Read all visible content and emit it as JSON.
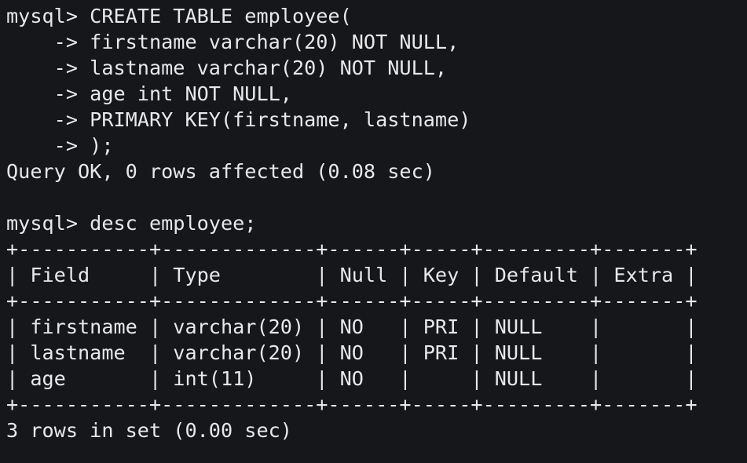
{
  "terminal": {
    "lines": [
      "mysql> CREATE TABLE employee(",
      "    -> firstname varchar(20) NOT NULL,",
      "    -> lastname varchar(20) NOT NULL,",
      "    -> age int NOT NULL,",
      "    -> PRIMARY KEY(firstname, lastname)",
      "    -> );",
      "Query OK, 0 rows affected (0.08 sec)",
      "",
      "mysql> desc employee;",
      "+-----------+-------------+------+-----+---------+-------+",
      "| Field     | Type        | Null | Key | Default | Extra |",
      "+-----------+-------------+------+-----+---------+-------+",
      "| firstname | varchar(20) | NO   | PRI | NULL    |       |",
      "| lastname  | varchar(20) | NO   | PRI | NULL    |       |",
      "| age       | int(11)     | NO   |     | NULL    |       |",
      "+-----------+-------------+------+-----+---------+-------+",
      "3 rows in set (0.00 sec)"
    ]
  },
  "colors": {
    "background": "#16171a",
    "text": "#e8e8ea"
  }
}
